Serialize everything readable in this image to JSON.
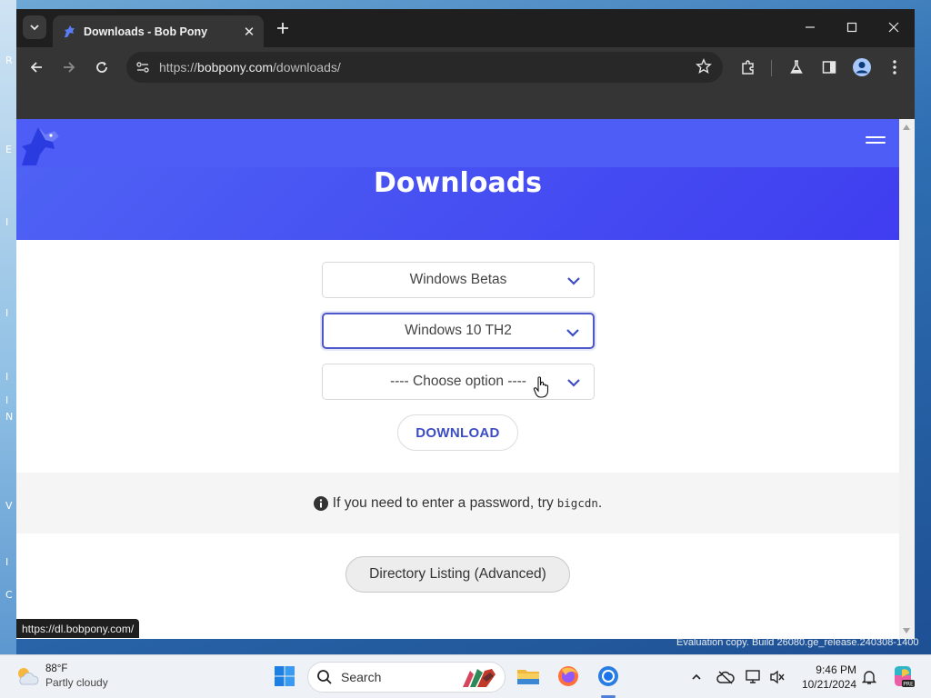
{
  "desktop": {
    "edge_letters": [
      "R",
      "E",
      "I",
      "I",
      "I",
      "I",
      "N",
      "V",
      "I",
      "C"
    ]
  },
  "browser": {
    "tab": {
      "title": "Downloads - Bob Pony"
    },
    "omnibox": {
      "url_prefix": "https://",
      "url_host": "bobpony.com",
      "url_path": "/downloads/"
    },
    "status_url": "https://dl.bobpony.com/"
  },
  "page": {
    "title": "Downloads",
    "select1": {
      "value": "Windows Betas"
    },
    "select2": {
      "value": "Windows 10 TH2"
    },
    "select3": {
      "value": "---- Choose option ----"
    },
    "download_label": "DOWNLOAD",
    "notice": {
      "text": "If you need to enter a password, try",
      "password": "bigcdn",
      "end": "."
    },
    "directory_label": "Directory Listing (Advanced)"
  },
  "watermark": "Evaluation copy. Build 26080.ge_release.240308-1400",
  "taskbar": {
    "weather": {
      "temp": "88°F",
      "condition": "Partly cloudy"
    },
    "search_label": "Search",
    "time": "9:46 PM",
    "date": "10/21/2024"
  },
  "colors": {
    "brand_blue": "#4d5df5",
    "link_blue": "#3c4cc4"
  }
}
